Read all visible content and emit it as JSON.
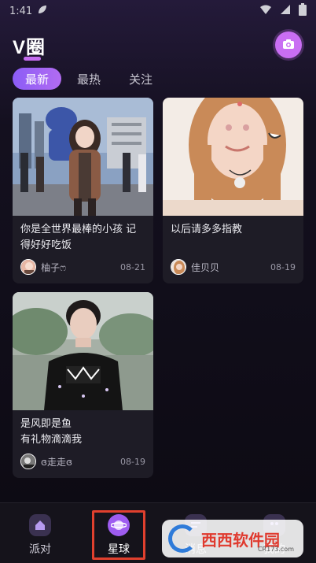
{
  "status_bar": {
    "time": "1:41"
  },
  "header": {
    "logo": "V圈"
  },
  "tabs": [
    {
      "label": "最新",
      "active": true
    },
    {
      "label": "最热",
      "active": false
    },
    {
      "label": "关注",
      "active": false
    }
  ],
  "posts": [
    {
      "title": "你是全世界最棒的小孩 记得好好吃饭",
      "author": "柚子ෆ",
      "date": "08-21"
    },
    {
      "title": "以后请多多指教",
      "author": "佳贝贝",
      "date": "08-19"
    },
    {
      "title": "是风即是鱼\n有礼物滴滴我",
      "author": "ɞ走走ɞ",
      "date": "08-19"
    }
  ],
  "bottom_nav": [
    {
      "label": "派对"
    },
    {
      "label": "星球"
    },
    {
      "label": "消息"
    },
    {
      "label": "我的"
    }
  ],
  "watermark": {
    "brand": "西西软件园",
    "url": "CR173.com"
  },
  "colors": {
    "accent": "#b26cf2",
    "highlight_frame": "#e0402e"
  }
}
